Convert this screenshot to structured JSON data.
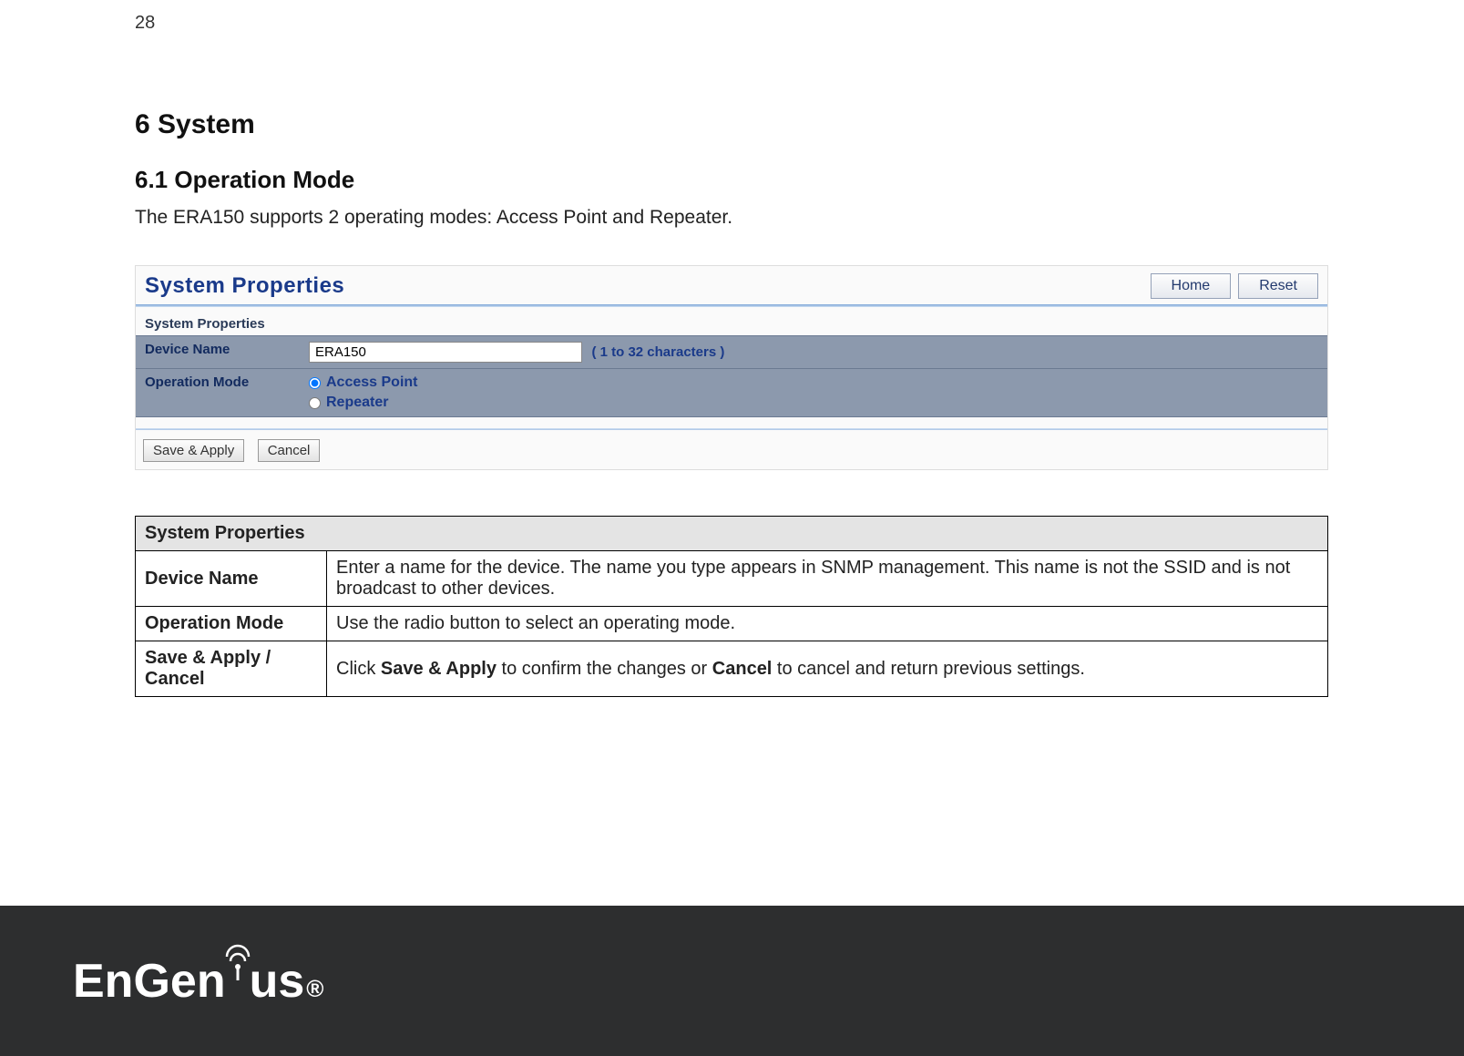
{
  "page_number": "28",
  "heading_1": "6  System",
  "heading_2": "6.1   Operation Mode",
  "intro_text": "The ERA150 supports 2 operating modes: Access Point and Repeater.",
  "ui": {
    "panel_title": "System Properties",
    "home_btn": "Home",
    "reset_btn": "Reset",
    "section_label": "System Properties",
    "device_name_label": "Device Name",
    "device_name_value": "ERA150",
    "device_name_hint": "( 1 to 32 characters )",
    "op_mode_label": "Operation Mode",
    "op_mode_option_1": "Access Point",
    "op_mode_option_2": "Repeater",
    "save_apply_btn": "Save & Apply",
    "cancel_btn": "Cancel"
  },
  "desc": {
    "header": "System Properties",
    "rows": [
      {
        "name": "Device Name",
        "text": "Enter a name for the device. The name you type appears in SNMP management. This name is not the SSID and is not broadcast to other devices."
      },
      {
        "name": "Operation Mode",
        "text": "Use the radio button to select an operating mode."
      },
      {
        "name": "Save & Apply / Cancel",
        "text_pre": "Click ",
        "bold1": "Save & Apply",
        "text_mid": " to confirm the changes or ",
        "bold2": "Cancel",
        "text_post": " to cancel and return previous settings."
      }
    ]
  },
  "footer": {
    "brand_pre": "EnGen",
    "brand_post": "us"
  }
}
